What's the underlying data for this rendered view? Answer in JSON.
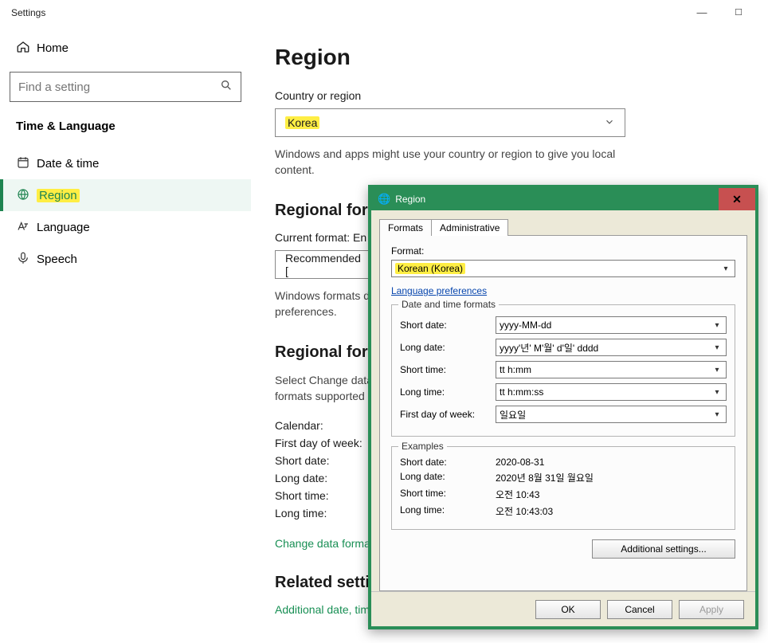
{
  "settings": {
    "title": "Settings",
    "home_label": "Home",
    "search_placeholder": "Find a setting",
    "group_heading": "Time & Language",
    "nav": {
      "date_time": "Date & time",
      "region": "Region",
      "language": "Language",
      "speech": "Speech"
    }
  },
  "page": {
    "title": "Region",
    "country_label": "Country or region",
    "country_value": "Korea",
    "country_help": "Windows and apps might use your country or region to give you local content.",
    "regional_format_heading": "Regional format",
    "current_format_label": "Current format: En",
    "recommended_option": "Recommended [",
    "format_help": "Windows formats dates and times based on your language and regional preferences.",
    "regional_format_data_heading": "Regional format data",
    "regional_format_data_help": "Select Change data formats to switch among calendars, date, and time formats supported by the region.",
    "rows": {
      "calendar": "Calendar:",
      "first_day": "First day of week:",
      "short_date": "Short date:",
      "long_date": "Long date:",
      "short_time": "Short time:",
      "long_time": "Long time:"
    },
    "change_data_formats": "Change data formats",
    "related_settings": "Related settings",
    "additional_link": "Additional date, time, & regional settings"
  },
  "dialog": {
    "title": "Region",
    "tab_formats": "Formats",
    "tab_administrative": "Administrative",
    "format_label": "Format:",
    "format_value": "Korean (Korea)",
    "language_prefs": "Language preferences",
    "dtf_heading": "Date and time formats",
    "labels": {
      "short_date": "Short date:",
      "long_date": "Long date:",
      "short_time": "Short time:",
      "long_time": "Long time:",
      "first_day": "First day of week:"
    },
    "values": {
      "short_date": "yyyy-MM-dd",
      "long_date": "yyyy'년' M'월' d'일' dddd",
      "short_time": "tt h:mm",
      "long_time": "tt h:mm:ss",
      "first_day": "일요일"
    },
    "examples_heading": "Examples",
    "examples": {
      "short_date": "2020-08-31",
      "long_date": "2020년 8월 31일 월요일",
      "short_time": "오전 10:43",
      "long_time": "오전 10:43:03"
    },
    "additional_settings": "Additional settings...",
    "ok": "OK",
    "cancel": "Cancel",
    "apply": "Apply"
  }
}
